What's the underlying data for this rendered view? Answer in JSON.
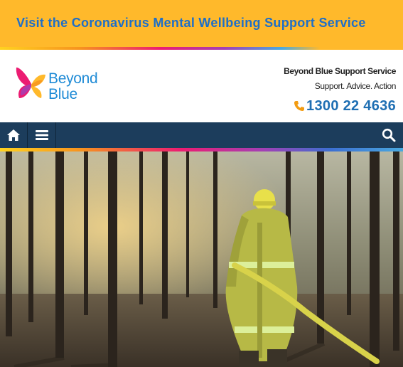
{
  "banner": {
    "link_text": "Visit the Coronavirus Mental Wellbeing Support Service"
  },
  "logo": {
    "line1": "Beyond",
    "line2": "Blue"
  },
  "header": {
    "service_title": "Beyond Blue Support Service",
    "tagline": "Support. Advice. Action",
    "phone": "1300 22 4636"
  },
  "nav": {
    "home_icon": "home-icon",
    "menu_icon": "hamburger-menu-icon",
    "search_icon": "search-icon"
  },
  "hero": {
    "image": "firefighter walking through burnt forest holding a fire hose"
  },
  "colors": {
    "banner_bg": "#ffb92b",
    "banner_text": "#1e6fc8",
    "nav_bg": "#1c3d5c",
    "logo_text": "#1f8bd6",
    "phone_text": "#1f6fb3",
    "phone_icon": "#f39c12"
  }
}
